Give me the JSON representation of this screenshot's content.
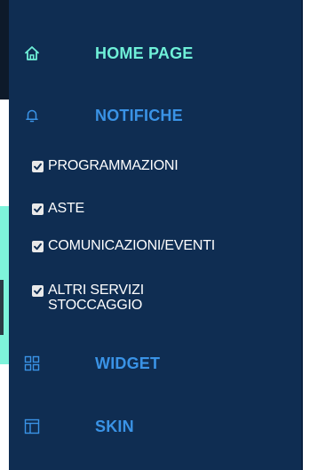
{
  "menu": {
    "home": {
      "label": "HOME PAGE",
      "icon": "home-icon",
      "color": "#6ff0d8"
    },
    "notifications": {
      "label": "NOTIFICHE",
      "icon": "bell-icon",
      "color": "#3a93e6",
      "options": [
        {
          "label": "PROGRAMMAZIONI",
          "checked": true
        },
        {
          "label": "ASTE",
          "checked": true
        },
        {
          "label": "COMUNICAZIONI/EVENTI",
          "checked": true
        },
        {
          "label": "ALTRI SERVIZI STOCCAGGIO",
          "checked": true
        }
      ]
    },
    "widget": {
      "label": "WIDGET",
      "icon": "grid-icon",
      "color": "#3a93e6"
    },
    "skin": {
      "label": "SKIN",
      "icon": "layout-icon",
      "color": "#3a93e6"
    }
  },
  "colors": {
    "menu_background": "#0f2d52",
    "checkbox": "#e9e9e9",
    "check_text": "#ffffff"
  }
}
